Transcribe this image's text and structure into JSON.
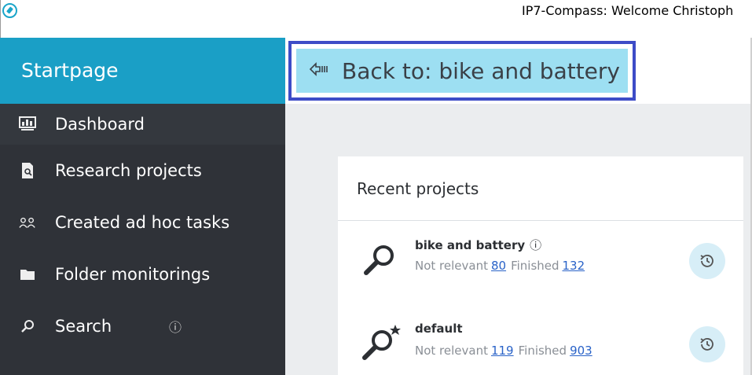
{
  "window": {
    "title": "IP7-Compass: Welcome Christoph",
    "app_icon": "compass-icon"
  },
  "sidebar": {
    "header": "Startpage",
    "items": [
      {
        "label": "Dashboard",
        "icon": "dashboard-icon"
      },
      {
        "label": "Research projects",
        "icon": "document-search-icon"
      },
      {
        "label": "Created ad hoc tasks",
        "icon": "users-icon"
      },
      {
        "label": "Folder monitorings",
        "icon": "folder-icon"
      },
      {
        "label": "Search",
        "icon": "search-icon",
        "info": "ⓘ"
      }
    ]
  },
  "topbar": {
    "back_label": "Back to: bike and battery",
    "back_icon": "back-arrow-icon"
  },
  "recent": {
    "title": "Recent projects",
    "projects": [
      {
        "name": "bike and battery",
        "info": "ⓘ",
        "not_relevant_label": "Not relevant",
        "not_relevant": "80",
        "finished_label": "Finished",
        "finished": "132",
        "icon": "search-project-icon"
      },
      {
        "name": "default",
        "not_relevant_label": "Not relevant",
        "not_relevant": "119",
        "finished_label": "Finished",
        "finished": "903",
        "icon": "search-project-star-icon"
      }
    ]
  },
  "colors": {
    "accent": "#1a9fc6",
    "sidebar_bg": "#2f3238",
    "back_button_bg": "#9ddff2",
    "highlight_border": "#3d4cc7"
  }
}
